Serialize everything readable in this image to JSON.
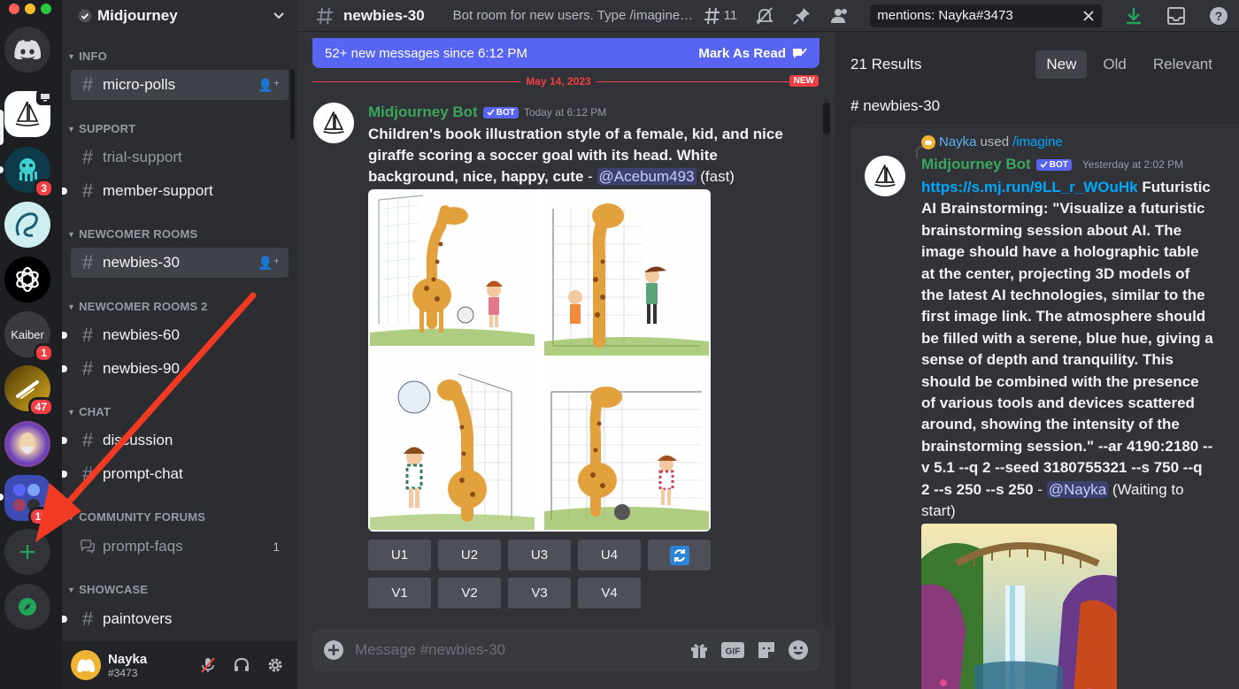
{
  "server": {
    "name": "Midjourney"
  },
  "rail": {
    "badges": {
      "octo": "3",
      "kaiber": "1",
      "light": "47",
      "folder": "12"
    },
    "kaiber_label": "Kaiber"
  },
  "sidebar": {
    "categories": [
      {
        "label": "INFO"
      },
      {
        "label": "SUPPORT"
      },
      {
        "label": "NEWCOMER ROOMS"
      },
      {
        "label": "NEWCOMER ROOMS 2"
      },
      {
        "label": "CHAT"
      },
      {
        "label": "COMMUNITY FORUMS"
      },
      {
        "label": "SHOWCASE"
      }
    ],
    "channels": {
      "micro_polls": "micro-polls",
      "trial_support": "trial-support",
      "member_support": "member-support",
      "newbies_30": "newbies-30",
      "newbies_60": "newbies-60",
      "newbies_90": "newbies-90",
      "discussion": "discussion",
      "prompt_chat": "prompt-chat",
      "prompt_faqs": "prompt-faqs",
      "prompt_faqs_count": "1",
      "paintovers": "paintovers"
    }
  },
  "user": {
    "name": "Nayka",
    "tag": "#3473"
  },
  "topbar": {
    "channel": "newbies-30",
    "topic": "Bot room for new users. Type /imagine then describe what you want to draw.",
    "threads_count": "11",
    "search_value": "mentions: Nayka#3473"
  },
  "chat": {
    "banner_text": "52+ new messages since 6:12 PM",
    "mark_read": "Mark As Read",
    "date": "May 14, 2023",
    "new_tag": "NEW",
    "message": {
      "author": "Midjourney Bot",
      "bot_tag": "BOT",
      "timestamp": "Today at 6:12 PM",
      "prompt": "Children's book illustration style of a female, kid, and nice giraffe scoring a soccer goal with its head. White background, nice, happy, cute",
      "dash": " - ",
      "mention": "@Acebum493",
      "mode": " (fast)"
    },
    "buttons_u": [
      "U1",
      "U2",
      "U3",
      "U4"
    ],
    "buttons_v": [
      "V1",
      "V2",
      "V3",
      "V4"
    ],
    "composer_placeholder": "Message #newbies-30"
  },
  "results": {
    "count": "21 Results",
    "sort": [
      "New",
      "Old",
      "Relevant"
    ],
    "channel": "newbies-30",
    "reply_user": "Nayka",
    "reply_used": "used",
    "reply_command": "/imagine",
    "author": "Midjourney Bot",
    "bot_tag": "BOT",
    "timestamp": "Yesterday at 2:02 PM",
    "link": "https://s.mj.run/9LL_r_WOuHk",
    "prompt": " Futuristic AI Brainstorming: \"Visualize a futuristic brainstorming session about AI. The image should have a holographic table at the center, projecting 3D models of the latest AI technologies, similar to the first image link. The atmosphere should be filled with a serene, blue hue, giving a sense of depth and tranquility. This should be combined with the presence of various tools and devices scattered around, showing the intensity of the brainstorming session.\" --ar 4190:2180 --v 5.1 --q 2 --seed 3180755321 --s 750 --q 2 --s 250 --s 250",
    "dash": " - ",
    "mention": "@Nayka",
    "status": " (Waiting to start)"
  },
  "colors": {
    "accent": "#5865f2",
    "danger": "#f23f43",
    "bot_green": "#3ba55c",
    "link": "#00a8fc"
  },
  "icons": [
    "discord-icon",
    "verified-check-icon",
    "chevron-down-icon",
    "hash-icon",
    "add-member-icon",
    "forum-icon",
    "threads-icon",
    "mute-icon",
    "pin-icon",
    "members-icon",
    "close-icon",
    "download-icon",
    "inbox-icon",
    "help-icon",
    "plus-icon",
    "compass-icon",
    "mic-muted-icon",
    "headphones-icon",
    "gear-icon",
    "gift-icon",
    "gif-icon",
    "sticker-icon",
    "emoji-icon",
    "refresh-icon",
    "mark-read-icon"
  ]
}
